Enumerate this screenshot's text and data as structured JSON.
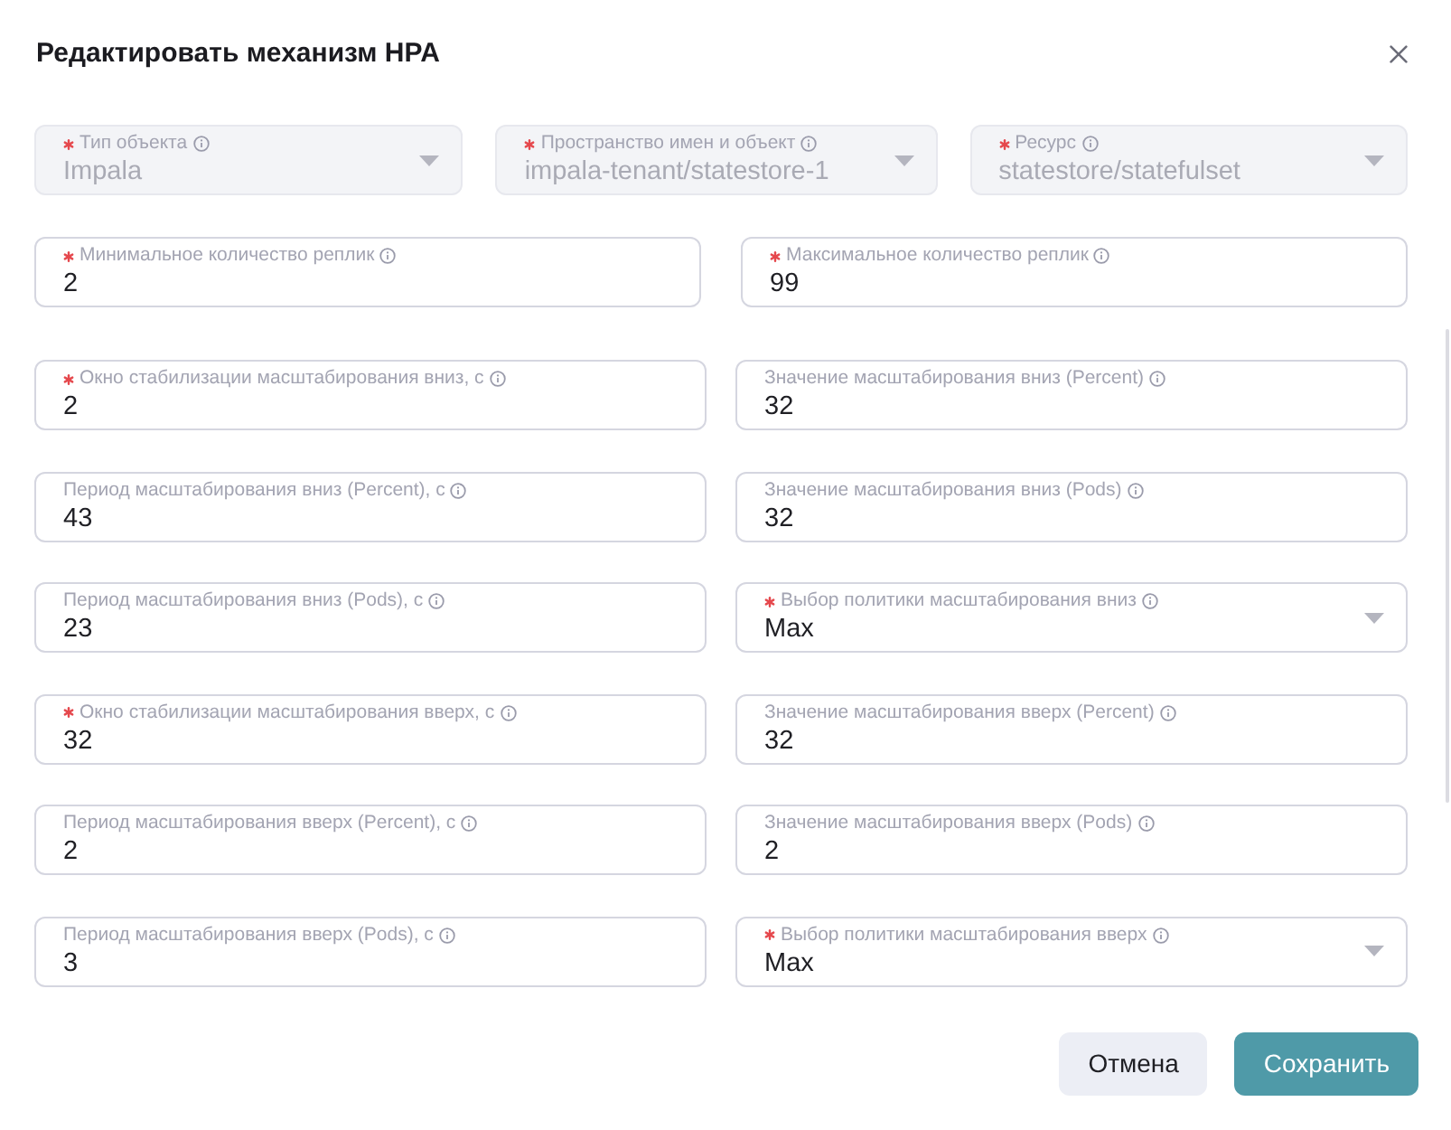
{
  "dialog": {
    "title": "Редактировать механизм HPA"
  },
  "object_fields": [
    {
      "kind": "select",
      "label": "Тип объекта",
      "required": true,
      "value": "Impala",
      "disabled": true
    },
    {
      "kind": "select",
      "label": "Пространство имен и объект",
      "required": true,
      "value": "impala-tenant/statestore-1",
      "disabled": true
    },
    {
      "kind": "select",
      "label": "Ресурс",
      "required": true,
      "value": "statestore/statefulset",
      "disabled": true
    }
  ],
  "replica_fields": [
    {
      "kind": "input",
      "label": "Минимальное количество реплик",
      "required": true,
      "value": "2",
      "disabled": false
    },
    {
      "kind": "input",
      "label": "Максимальное количество реплик",
      "required": true,
      "value": "99",
      "disabled": false
    }
  ],
  "scaling_fields": [
    {
      "kind": "input",
      "label": "Окно стабилизации масштабирования вниз, с",
      "required": true,
      "value": "2",
      "disabled": false
    },
    {
      "kind": "input",
      "label": "Значение масштабирования вниз (Percent)",
      "required": false,
      "value": "32",
      "disabled": false
    },
    {
      "kind": "input",
      "label": "Период масштабирования вниз (Percent), с",
      "required": false,
      "value": "43",
      "disabled": false
    },
    {
      "kind": "input",
      "label": "Значение масштабирования вниз (Pods)",
      "required": false,
      "value": "32",
      "disabled": false
    },
    {
      "kind": "input",
      "label": "Период масштабирования вниз (Pods), с",
      "required": false,
      "value": "23",
      "disabled": false
    },
    {
      "kind": "select",
      "label": "Выбор политики масштабирования вниз",
      "required": true,
      "value": "Max",
      "disabled": false
    },
    {
      "kind": "input",
      "label": "Окно стабилизации масштабирования вверх, с",
      "required": true,
      "value": "32",
      "disabled": false
    },
    {
      "kind": "input",
      "label": "Значение масштабирования вверх (Percent)",
      "required": false,
      "value": "32",
      "disabled": false
    },
    {
      "kind": "input",
      "label": "Период масштабирования вверх (Percent), с",
      "required": false,
      "value": "2",
      "disabled": false
    },
    {
      "kind": "input",
      "label": "Значение масштабирования вверх (Pods)",
      "required": false,
      "value": "2",
      "disabled": false
    },
    {
      "kind": "input",
      "label": "Период масштабирования вверх (Pods), с",
      "required": false,
      "value": "3",
      "disabled": false
    },
    {
      "kind": "select",
      "label": "Выбор политики масштабирования вверх",
      "required": true,
      "value": "Max",
      "disabled": false
    }
  ],
  "buttons": [
    {
      "kind": "secondary",
      "label": "Отмена"
    },
    {
      "kind": "primary",
      "label": "Сохранить"
    }
  ]
}
